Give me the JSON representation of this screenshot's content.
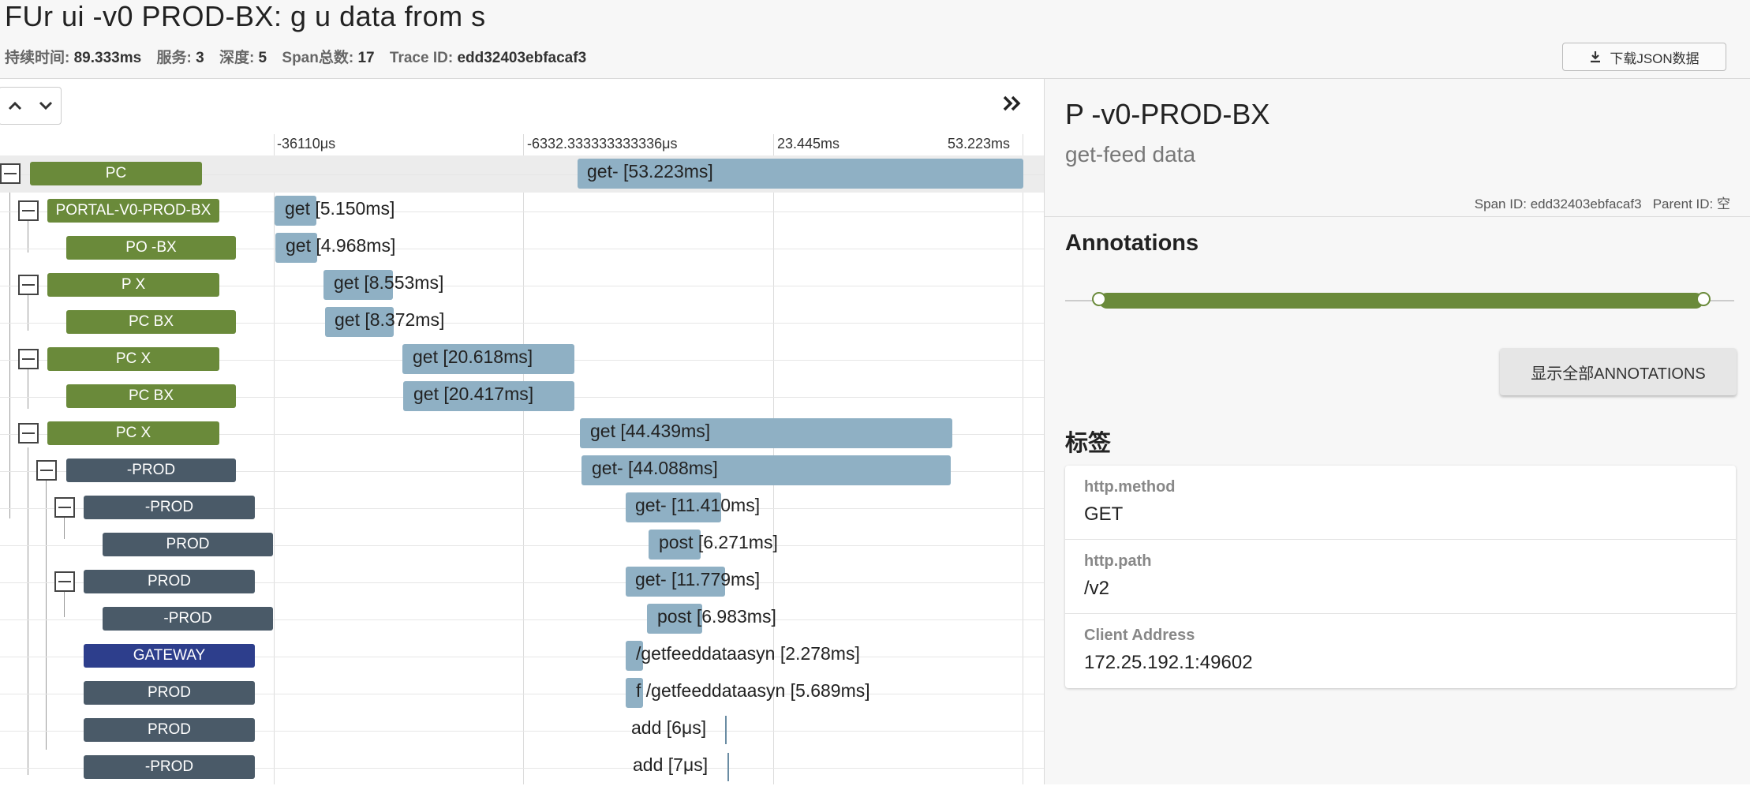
{
  "header": {
    "title": "FUr ui -v0 PROD-BX: g         u  data  from  s",
    "stats": [
      {
        "label": "持续时间:",
        "value": "89.333ms"
      },
      {
        "label": "服务:",
        "value": "3"
      },
      {
        "label": "深度:",
        "value": "5"
      },
      {
        "label": "Span总数:",
        "value": "17"
      },
      {
        "label": "Trace ID:",
        "value": "edd32403ebfacaf3"
      }
    ],
    "download_label": "下载JSON数据"
  },
  "timeline": {
    "ticks": [
      "-36110μs",
      "-6332.333333333336μs",
      "23.445ms",
      "53.223ms"
    ]
  },
  "rows": [
    {
      "svc": "PC",
      "label": "get-                [53.223ms]"
    },
    {
      "svc": "PORTAL-V0-PROD-BX",
      "label": "get [5.150ms]"
    },
    {
      "svc": "PO          -BX",
      "label": "get [4.968ms]"
    },
    {
      "svc": "P                X",
      "label": "get [8.553ms]"
    },
    {
      "svc": "PC              BX",
      "label": "get [8.372ms]"
    },
    {
      "svc": "PC              X",
      "label": "get [20.618ms]"
    },
    {
      "svc": "PC              BX",
      "label": "get [20.417ms]"
    },
    {
      "svc": "PC             X",
      "label": "get [44.439ms]"
    },
    {
      "svc": "    -PROD",
      "label": "get-         [44.088ms]"
    },
    {
      "svc": "     -PROD",
      "label": "get-   [11.410ms]"
    },
    {
      "svc": "     PROD",
      "label": "post [6.271ms]"
    },
    {
      "svc": "   PROD",
      "label": "get-   [11.779ms]"
    },
    {
      "svc": "   -PROD",
      "label": "post [6.983ms]"
    },
    {
      "svc": "   GATEWAY",
      "label": "               /getfeeddataasyn [2.278ms]"
    },
    {
      "svc": "   PROD",
      "label": "f               /getfeeddataasyn [5.689ms]"
    },
    {
      "svc": "   PROD",
      "label": "add [6μs]"
    },
    {
      "svc": "  -PROD",
      "label": "add [7μs]"
    }
  ],
  "detail": {
    "service_name": "P     -v0-PROD-BX",
    "span_name": "get-feed        data",
    "span_id_label": "Span ID:",
    "span_id": "edd32403ebfacaf3",
    "parent_id_label": "Parent ID:",
    "parent_id": "空",
    "annotations_title": "Annotations",
    "show_all_label": "显示全部ANNOTATIONS",
    "tags_title": "标签",
    "tags": [
      {
        "key": "http.method",
        "value": "GET"
      },
      {
        "key": "http.path",
        "value": "     /v2"
      },
      {
        "key": "Client Address",
        "value": "172.25.192.1:49602"
      }
    ]
  },
  "colors": {
    "service_green": "#6a8a3a",
    "service_dark": "#4a5a68",
    "service_blue": "#2d3e8c",
    "span_bar": "#8fb0c4"
  }
}
